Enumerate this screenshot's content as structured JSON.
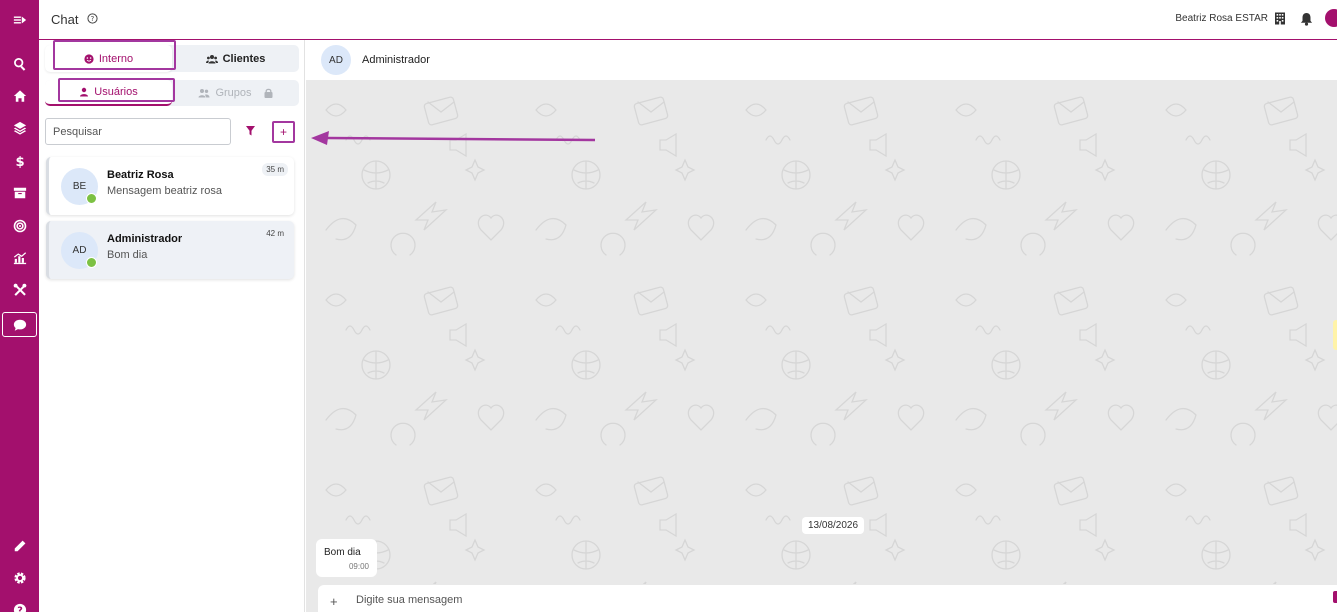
{
  "header": {
    "title": "Chat",
    "user_name": "Beatriz Rosa ESTAR"
  },
  "panel": {
    "tabs": [
      {
        "label": "Interno",
        "icon": "face-icon",
        "selected": true
      },
      {
        "label": "Clientes",
        "icon": "people-icon",
        "selected": false
      }
    ],
    "subtabs": [
      {
        "label": "Usuários",
        "icon": "person-icon",
        "selected": true
      },
      {
        "label": "Grupos",
        "icon": "group-icon",
        "selected": false,
        "locked": true
      }
    ],
    "search": {
      "placeholder": "Pesquisar"
    },
    "add_label": "+",
    "conversations": [
      {
        "initials": "BE",
        "name": "Beatriz Rosa",
        "last_message": "Mensagem beatriz rosa",
        "time": "35 m",
        "online": true
      },
      {
        "initials": "AD",
        "name": "Administrador",
        "last_message": "Bom dia",
        "time": "42 m",
        "online": true
      }
    ]
  },
  "chat": {
    "contact_initials": "AD",
    "contact_name": "Administrador",
    "date_separator": "13/08/2026",
    "messages": [
      {
        "text": "Bom dia",
        "time": "09:00"
      }
    ],
    "composer": {
      "plus": "+",
      "placeholder": "Digite sua mensagem"
    }
  },
  "colors": {
    "brand": "#a3106d",
    "highlight": "#a3379f",
    "online": "#7cc143",
    "chat_bg": "#e9e9e9"
  },
  "rail_icons": [
    "menu-collapse-icon",
    "search-icon",
    "home-icon",
    "layers-icon",
    "dollar-icon",
    "archive-icon",
    "target-icon",
    "chart-icon",
    "tools-icon",
    "chat-bubble-icon",
    "pencil-icon",
    "gear-icon",
    "help-icon"
  ]
}
